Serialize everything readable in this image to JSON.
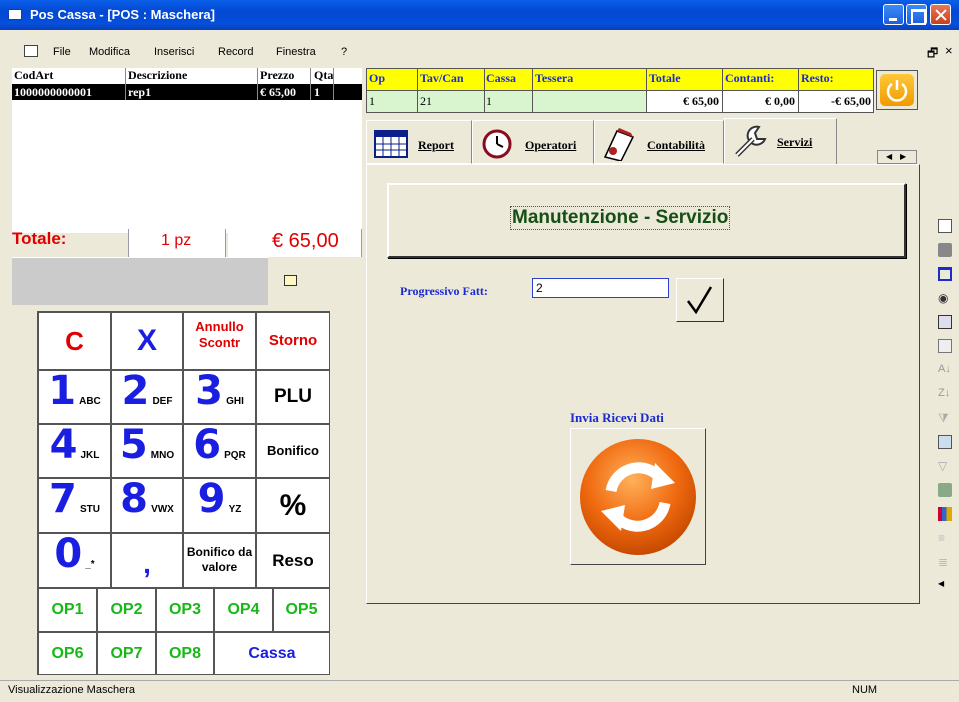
{
  "window": {
    "title": "Pos Cassa - [POS : Maschera]",
    "controls": [
      "minimize-icon",
      "maximize-icon",
      "close-icon"
    ]
  },
  "menu": {
    "items": [
      "File",
      "Modifica",
      "Inserisci",
      "Record",
      "Finestra",
      "?"
    ],
    "mdi_restore": "🗗",
    "mdi_close": "×"
  },
  "articles": {
    "headers": [
      "CodArt",
      "Descrizione",
      "Prezzo",
      "Qta"
    ],
    "rows": [
      {
        "codart": "1000000000001",
        "descrizione": "rep1",
        "prezzo": "€ 65,00",
        "qta": "1"
      }
    ]
  },
  "totals": {
    "label": "Totale:",
    "pieces": "1 pz",
    "amount": "€ 65,00"
  },
  "keypad": {
    "c": "C",
    "x": "X",
    "annullo": "Annullo Scontr",
    "storno": "Storno",
    "plu": "PLU",
    "bonifico": "Bonifico",
    "percent": "%",
    "bonifico_valore": "Bonifico da valore",
    "reso": "Reso",
    "comma": ",",
    "digits": [
      {
        "d": "1",
        "s": "ABC"
      },
      {
        "d": "2",
        "s": "DEF"
      },
      {
        "d": "3",
        "s": "GHI"
      },
      {
        "d": "4",
        "s": "JKL"
      },
      {
        "d": "5",
        "s": "MNO"
      },
      {
        "d": "6",
        "s": "PQR"
      },
      {
        "d": "7",
        "s": "STU"
      },
      {
        "d": "8",
        "s": "VWX"
      },
      {
        "d": "9",
        "s": "YZ"
      },
      {
        "d": "0",
        "s": "_*"
      }
    ],
    "ops": [
      "OP1",
      "OP2",
      "OP3",
      "OP4",
      "OP5",
      "OP6",
      "OP7",
      "OP8"
    ],
    "cassa": "Cassa"
  },
  "header_grid": {
    "labels": [
      "Op",
      "Tav/Can",
      "Cassa",
      "Tessera",
      "Totale",
      "Contanti:",
      "Resto:"
    ],
    "values": {
      "op": "1",
      "tav": "21",
      "cassa": "1",
      "tessera": "",
      "totale": "€ 65,00",
      "contanti": "€ 0,00",
      "resto": "-€ 65,00"
    }
  },
  "tabs": [
    "Report",
    "Operatori",
    "Contabilità",
    "Servizi"
  ],
  "panel": {
    "title": "Manutenzione - Servizio",
    "progressivo_label": "Progressivo Fatt:",
    "progressivo_value": "2",
    "invia_label": "Invia Ricevi Dati"
  },
  "statusbar": {
    "text": "Visualizzazione Maschera",
    "num": "NUM"
  },
  "colors": {
    "titlebar": "#0550dc",
    "total_red": "#e00000",
    "keypad_blue": "#1a1ee0",
    "ops_green": "#18b818",
    "header_yellow": "#ffff00",
    "values_green": "#d8f5d0"
  }
}
